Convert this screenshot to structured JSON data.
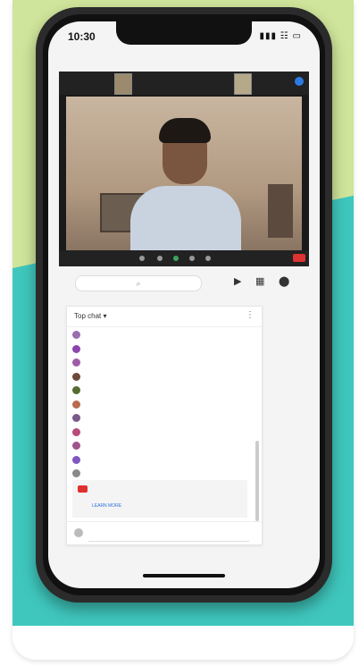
{
  "status_bar": {
    "time": "10:30",
    "icons": "▮▮▮ ☷ ▭"
  },
  "video": {
    "top_labels": [
      "",
      "",
      "",
      ""
    ],
    "cam_label": "",
    "participant_name": ""
  },
  "toolbar": {
    "search_placeholder": "⌕",
    "camera_icon": "▶",
    "grid_icon": "▦",
    "user_icon": "⬤"
  },
  "chat": {
    "title": "Top chat ▾",
    "menu": "⋮",
    "messages": [
      {
        "name": "",
        "text": "",
        "color": "#9a6fb0"
      },
      {
        "name": "",
        "text": "",
        "color": "#8e44ad"
      },
      {
        "name": "",
        "text": "",
        "color": "#a05aa8"
      },
      {
        "name": "",
        "text": "",
        "color": "#6b4a3a"
      },
      {
        "name": "",
        "text": "",
        "color": "#556b2f"
      },
      {
        "name": "",
        "text": "",
        "color": "#b86b4b"
      },
      {
        "name": "",
        "text": "",
        "color": "#7a5a8a"
      },
      {
        "name": "",
        "text": "",
        "color": "#b84b7a"
      },
      {
        "name": "",
        "text": "",
        "color": "#a0528b"
      },
      {
        "name": "",
        "text": "",
        "color": "#7e57c2"
      },
      {
        "name": "",
        "text": "",
        "color": "#8a8a8a"
      }
    ],
    "notice": {
      "text": "",
      "learn_more": "LEARN MORE"
    },
    "input": {
      "name": "",
      "placeholder": ""
    }
  }
}
